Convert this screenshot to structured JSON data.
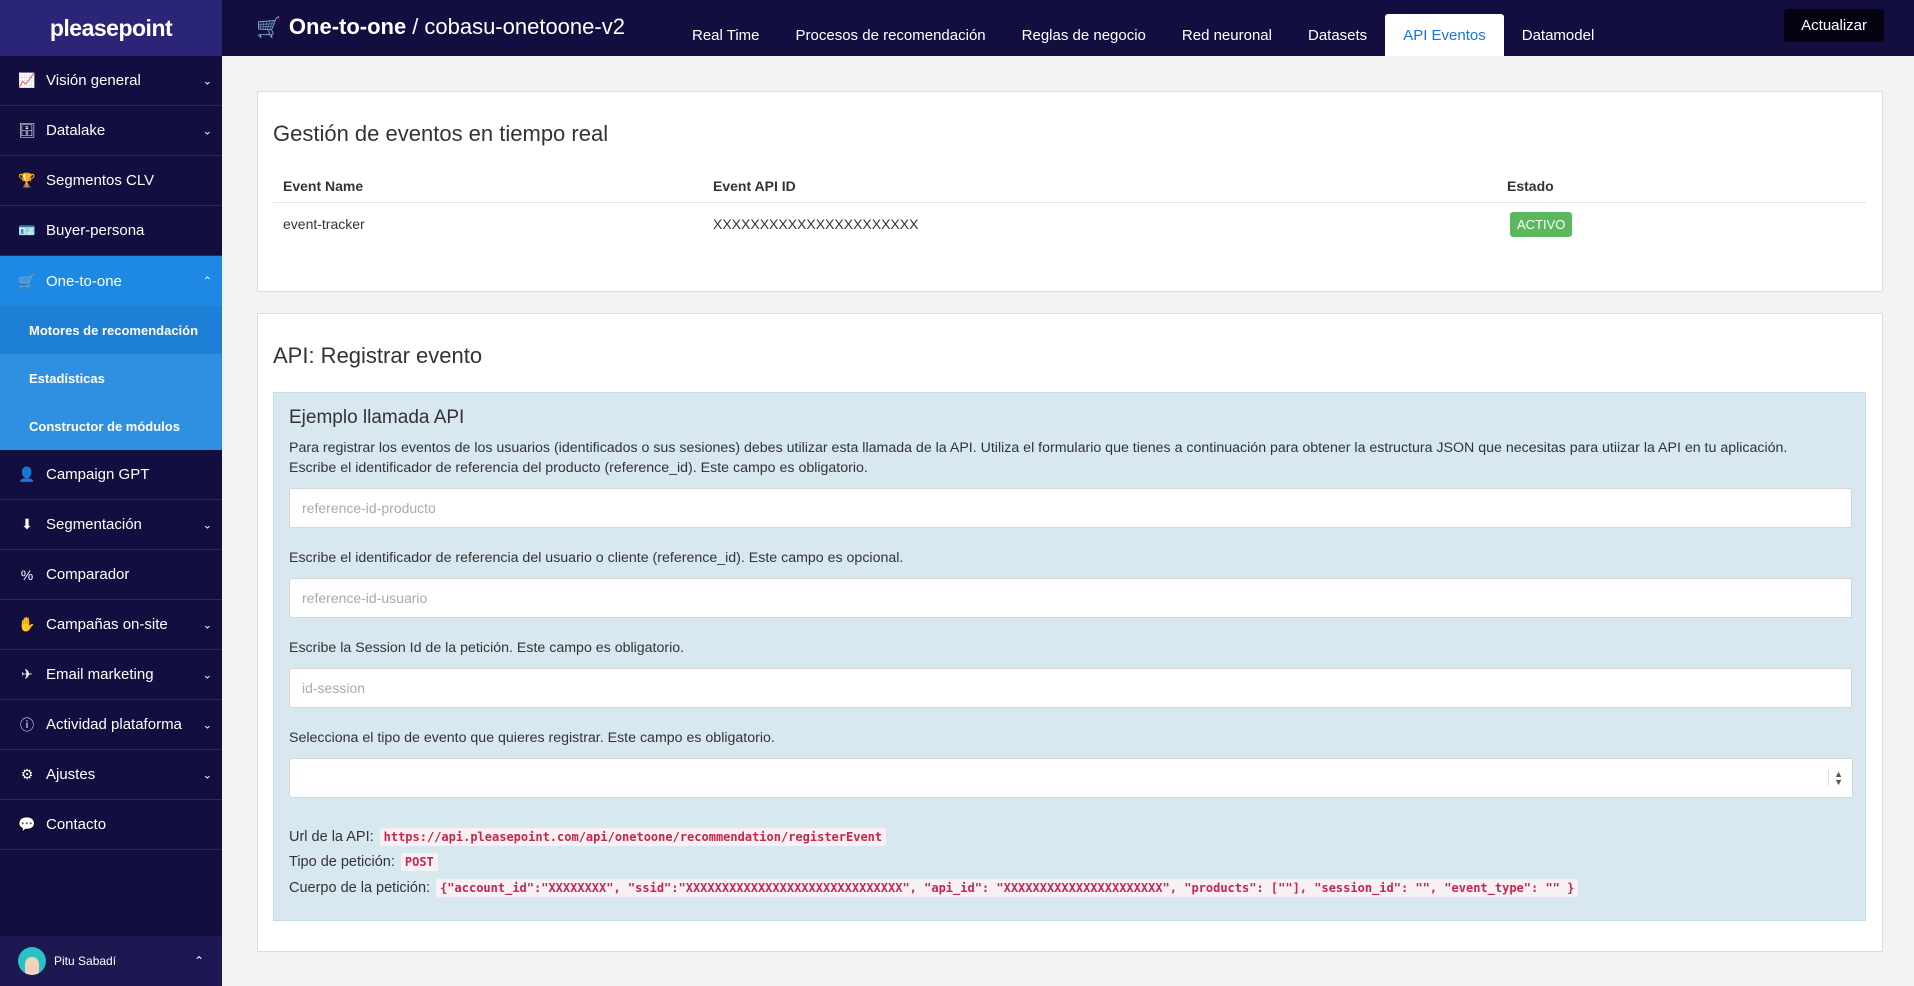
{
  "brand": "pleasepoint",
  "sidebar": {
    "items": [
      {
        "label": "Visión general",
        "icon": "chart-line-icon",
        "chevron": "down"
      },
      {
        "label": "Datalake",
        "icon": "database-icon",
        "chevron": "down"
      },
      {
        "label": "Segmentos CLV",
        "icon": "trophy-icon"
      },
      {
        "label": "Buyer-persona",
        "icon": "id-card-icon"
      },
      {
        "label": "One-to-one",
        "icon": "cart-icon",
        "chevron": "up",
        "active": true
      },
      {
        "label": "Campaign GPT",
        "icon": "user-icon"
      },
      {
        "label": "Segmentación",
        "icon": "download-icon",
        "chevron": "down"
      },
      {
        "label": "Comparador",
        "icon": "percent-icon"
      },
      {
        "label": "Campañas on-site",
        "icon": "hand-icon",
        "chevron": "down"
      },
      {
        "label": "Email marketing",
        "icon": "paper-plane-icon",
        "chevron": "down"
      },
      {
        "label": "Actividad plataforma",
        "icon": "info-icon",
        "chevron": "down"
      },
      {
        "label": "Ajustes",
        "icon": "gear-icon",
        "chevron": "down"
      },
      {
        "label": "Contacto",
        "icon": "chat-icon"
      }
    ],
    "subitems": [
      "Motores de recomendación",
      "Estadísticas",
      "Constructor de módulos"
    ],
    "user": {
      "name": "Pitu Sabadí"
    }
  },
  "header": {
    "title_bold": "One-to-one",
    "title_rest": "cobasu-onetoone-v2",
    "tabs": [
      "Real Time",
      "Procesos de recomendación",
      "Reglas de negocio",
      "Red neuronal",
      "Datasets",
      "API Eventos",
      "Datamodel"
    ],
    "active_tab": "API Eventos",
    "update_label": "Actualizar"
  },
  "events_panel": {
    "title": "Gestión de eventos en tiempo real",
    "columns": [
      "Event Name",
      "Event API ID",
      "Estado"
    ],
    "rows": [
      {
        "name": "event-tracker",
        "api_id": "XXXXXXXXXXXXXXXXXXXXXX",
        "status": "ACTIVO"
      }
    ]
  },
  "register_panel": {
    "title": "API: Registrar evento",
    "example_title": "Ejemplo llamada API",
    "intro": "Para registrar los eventos de los usuarios (identificados o sus sesiones) debes utilizar esta llamada de la API. Utiliza el formulario que tienes a continuación para obtener la estructura JSON que necesitas para utiizar la API en tu aplicación.",
    "product_label": "Escribe el identificador de referencia del producto (reference_id). Este campo es obligatorio.",
    "product_placeholder": "reference-id-producto",
    "user_label": "Escribe el identificador de referencia del usuario o cliente (reference_id). Este campo es opcional.",
    "user_placeholder": "reference-id-usuario",
    "session_label": "Escribe la Session Id de la petición. Este campo es obligatorio.",
    "session_placeholder": "id-session",
    "event_type_label": "Selecciona el tipo de evento que quieres registrar. Este campo es obligatorio.",
    "event_type_value": "",
    "url_label": "Url de la API:",
    "url_value": "https://api.pleasepoint.com/api/onetoone/recommendation/registerEvent",
    "method_label": "Tipo de petición:",
    "method_value": "POST",
    "body_label": "Cuerpo de la petición:",
    "body_value": "{\"account_id\":\"XXXXXXXX\", \"ssid\":\"XXXXXXXXXXXXXXXXXXXXXXXXXXXXXX\", \"api_id\": \"XXXXXXXXXXXXXXXXXXXXXX\", \"products\": [\"\"], \"session_id\": \"\", \"event_type\": \"\" }"
  },
  "colors": {
    "sidebar_bg": "#120e40",
    "active_blue": "#1e88e5",
    "badge_green": "#5cb85c",
    "code_red": "#c7254e"
  }
}
